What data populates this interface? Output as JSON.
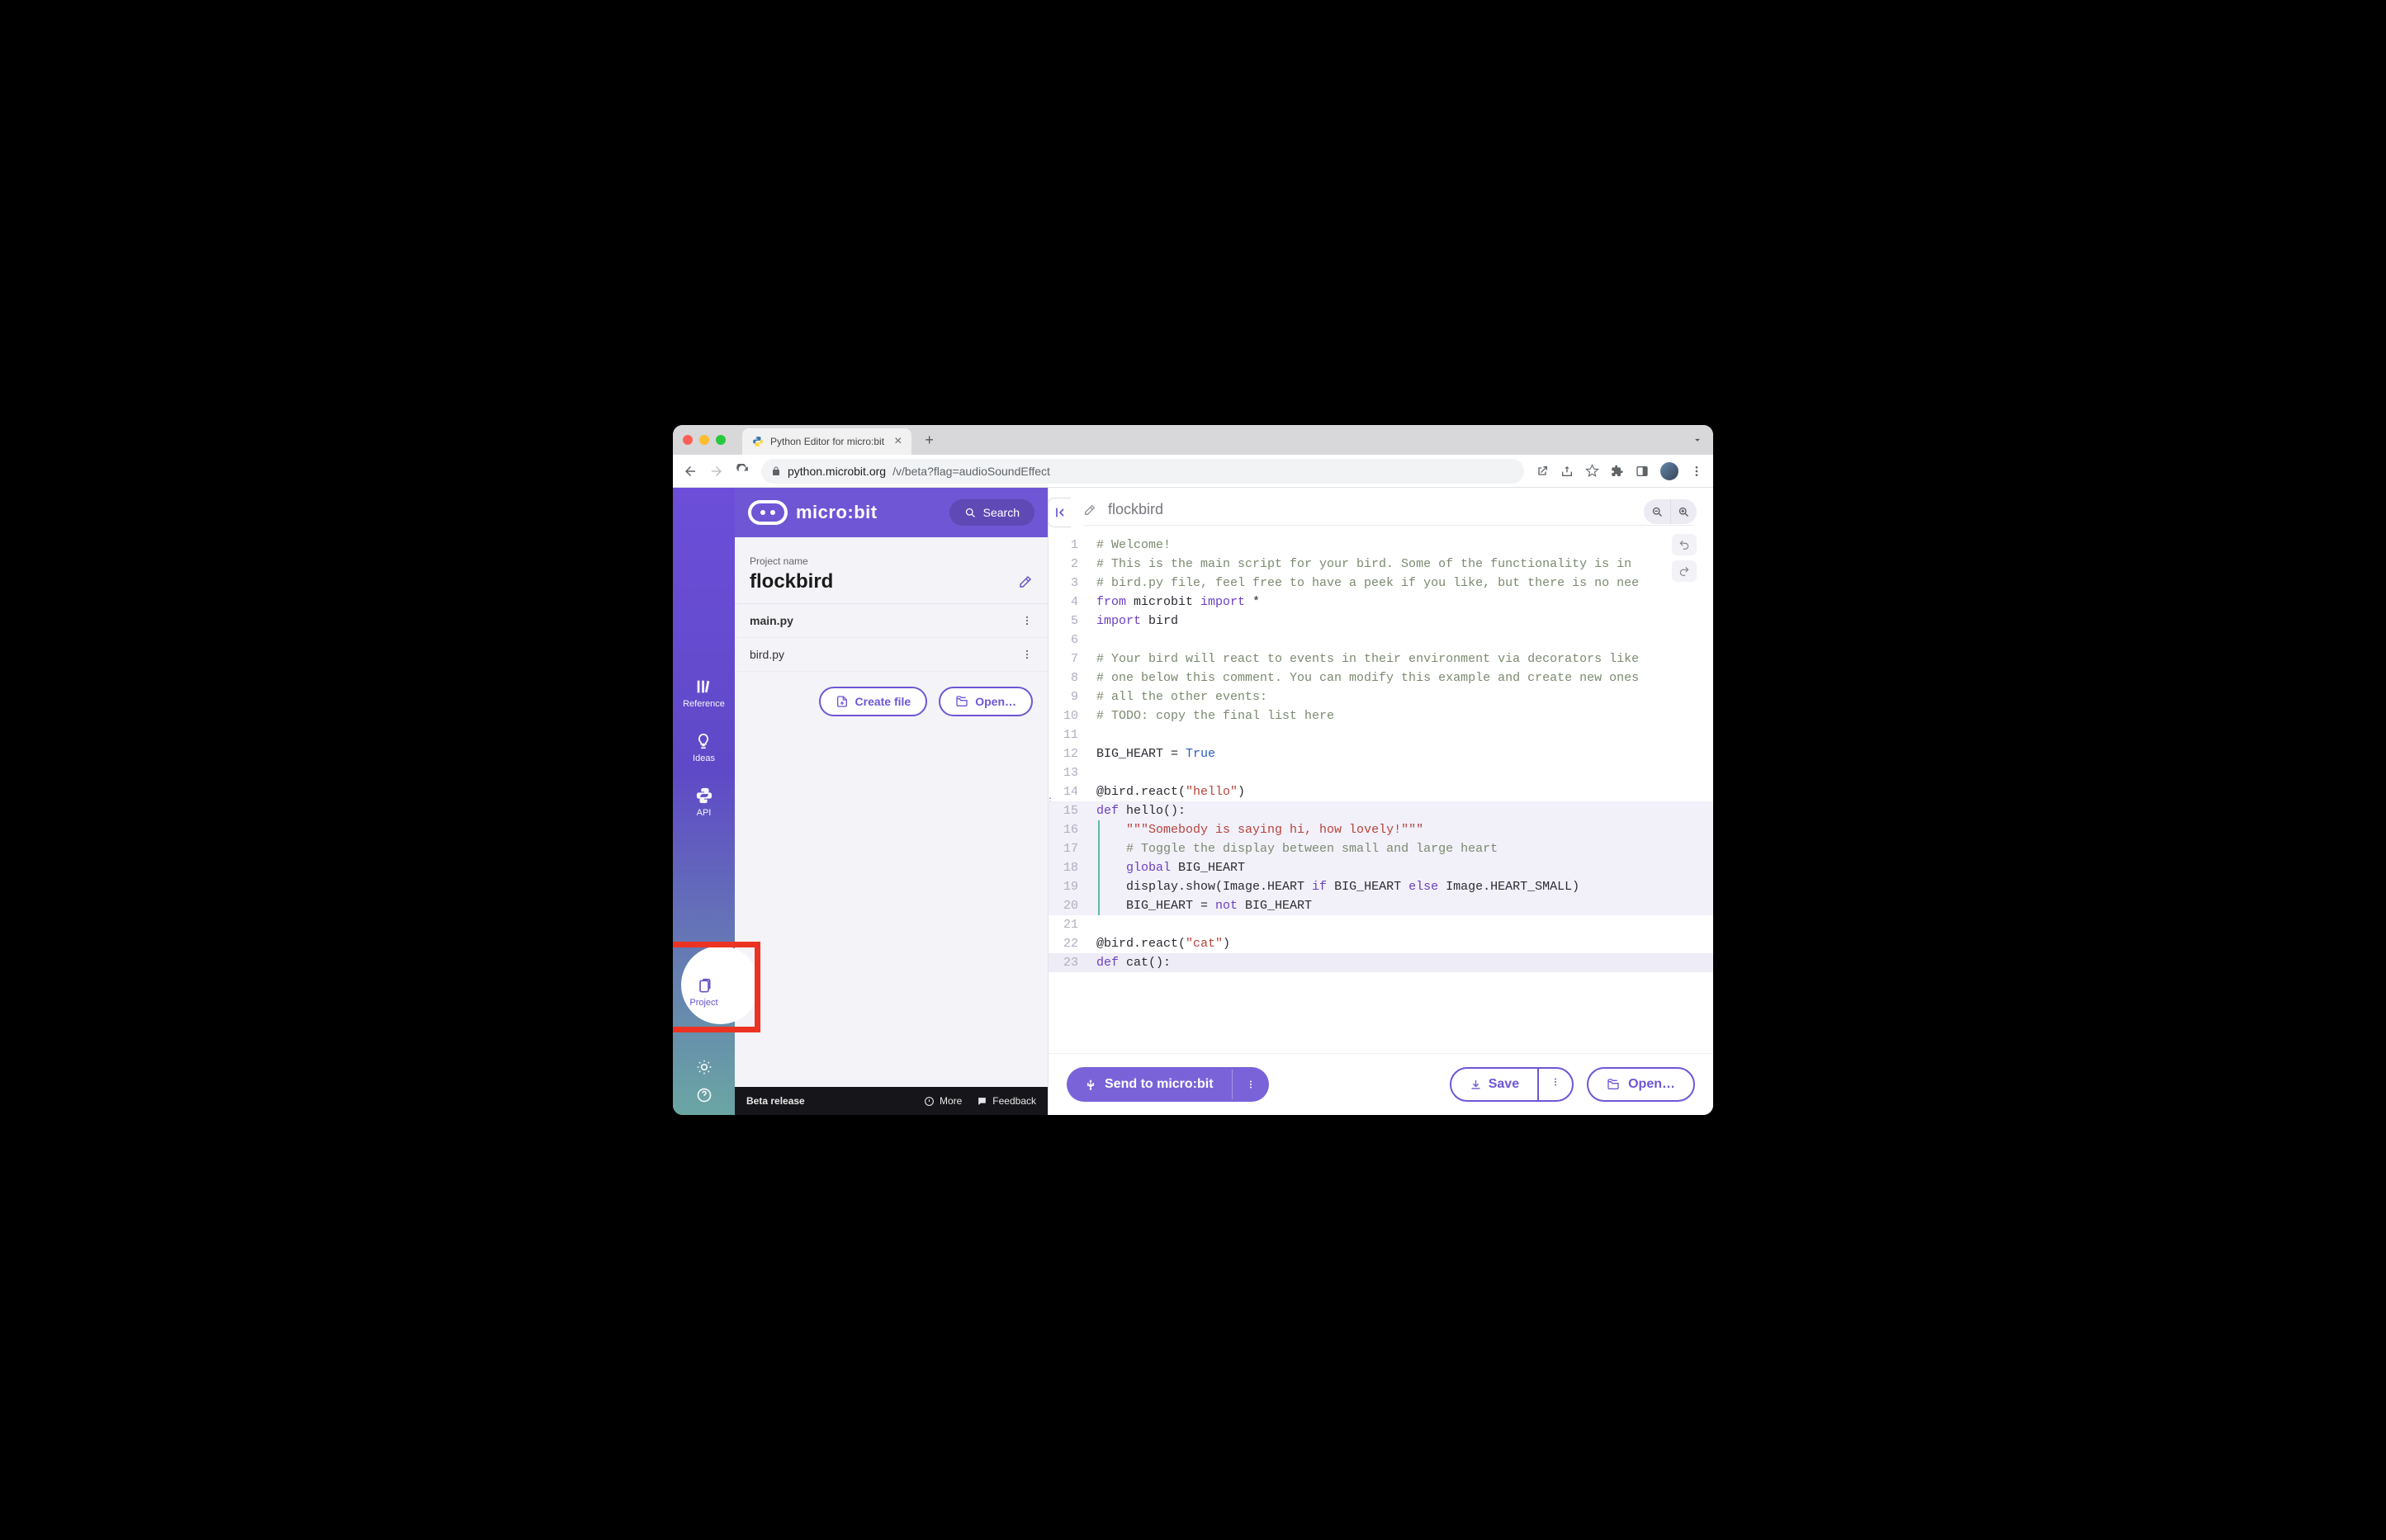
{
  "browser": {
    "tab_title": "Python Editor for micro:bit",
    "url_host": "python.microbit.org",
    "url_path": "/v/beta?flag=audioSoundEffect"
  },
  "brand": {
    "name": "micro:bit",
    "search_label": "Search"
  },
  "rail": {
    "reference": "Reference",
    "ideas": "Ideas",
    "api": "API",
    "project": "Project"
  },
  "project": {
    "label": "Project name",
    "name": "flockbird",
    "files": [
      "main.py",
      "bird.py"
    ],
    "create_label": "Create file",
    "open_label": "Open…"
  },
  "footer": {
    "beta": "Beta release",
    "more": "More",
    "feedback": "Feedback"
  },
  "editor": {
    "filename": "flockbird",
    "lines": [
      {
        "n": 1,
        "cls": "",
        "html": "<span class='c-cmt'># Welcome!</span>"
      },
      {
        "n": 2,
        "cls": "",
        "html": "<span class='c-cmt'># This is the main script for your bird. Some of the functionality is in</span>"
      },
      {
        "n": 3,
        "cls": "",
        "html": "<span class='c-cmt'># bird.py file, feel free to have a peek if you like, but there is no nee</span>"
      },
      {
        "n": 4,
        "cls": "",
        "html": "<span class='c-kw'>from</span> microbit <span class='c-kw'>import</span> *"
      },
      {
        "n": 5,
        "cls": "",
        "html": "<span class='c-kw'>import</span> bird"
      },
      {
        "n": 6,
        "cls": "",
        "html": ""
      },
      {
        "n": 7,
        "cls": "",
        "html": "<span class='c-cmt'># Your bird will react to events in their environment via decorators like</span>"
      },
      {
        "n": 8,
        "cls": "",
        "html": "<span class='c-cmt'># one below this comment. You can modify this example and create new ones</span>"
      },
      {
        "n": 9,
        "cls": "",
        "html": "<span class='c-cmt'># all the other events:</span>"
      },
      {
        "n": 10,
        "cls": "",
        "html": "<span class='c-cmt'># TODO: copy the final list here</span>"
      },
      {
        "n": 11,
        "cls": "",
        "html": ""
      },
      {
        "n": 12,
        "cls": "",
        "html": "BIG_HEART = <span class='c-bool'>True</span>"
      },
      {
        "n": 13,
        "cls": "",
        "html": ""
      },
      {
        "n": 14,
        "cls": "",
        "html": "@bird.react(<span class='c-str'>\"hello\"</span>)"
      },
      {
        "n": 15,
        "cls": "hl",
        "html": "<span class='c-kw'>def</span> <span class='c-fn'>hello</span>():"
      },
      {
        "n": 16,
        "cls": "hl",
        "html": "    <span class='c-doc'>\"\"\"Somebody is saying hi, how lovely!\"\"\"</span>",
        "guide": true
      },
      {
        "n": 17,
        "cls": "hl",
        "html": "    <span class='c-cmt'># Toggle the display between small and large heart</span>",
        "guide": true
      },
      {
        "n": 18,
        "cls": "hl",
        "html": "    <span class='c-kw'>global</span> BIG_HEART",
        "guide": true
      },
      {
        "n": 19,
        "cls": "hl",
        "html": "    display.show(Image.HEART <span class='c-kw'>if</span> BIG_HEART <span class='c-kw'>else</span> Image.HEART_SMALL)",
        "guide": true
      },
      {
        "n": 20,
        "cls": "hl",
        "html": "    BIG_HEART = <span class='c-kw'>not</span> BIG_HEART",
        "guide": true
      },
      {
        "n": 21,
        "cls": "",
        "html": ""
      },
      {
        "n": 22,
        "cls": "",
        "html": "@bird.react(<span class='c-str'>\"cat\"</span>)"
      },
      {
        "n": 23,
        "cls": "hl2",
        "html": "<span class='c-kw'>def</span> <span class='c-fn'>cat</span>():"
      }
    ]
  },
  "actions": {
    "send": "Send to micro:bit",
    "save": "Save",
    "open": "Open…"
  },
  "colors": {
    "brand": "#6f56d5",
    "highlight": "#ec3323"
  }
}
